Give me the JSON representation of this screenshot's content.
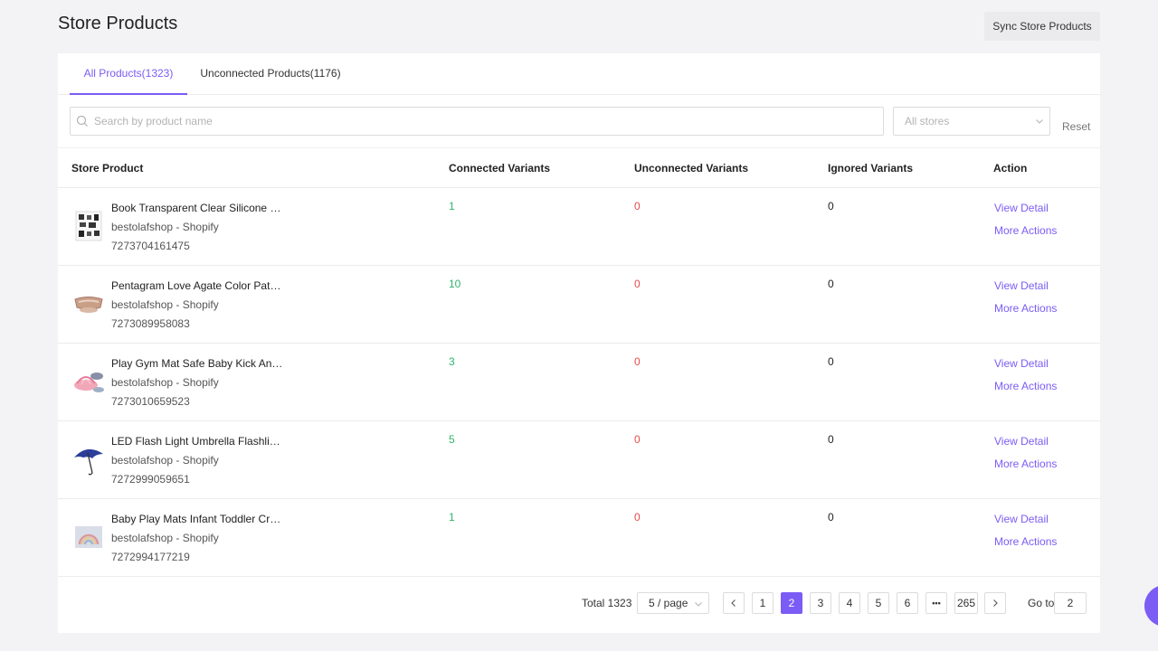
{
  "header": {
    "title": "Store Products",
    "sync_label": "Sync Store Products"
  },
  "tabs": [
    {
      "label": "All Products(1323)",
      "active": true
    },
    {
      "label": "Unconnected Products(1176)",
      "active": false
    }
  ],
  "filters": {
    "search_placeholder": "Search by product name",
    "store_placeholder": "All stores",
    "reset_label": "Reset"
  },
  "table": {
    "columns": [
      "Store Product",
      "Connected Variants",
      "Unconnected Variants",
      "Ignored Variants",
      "Action"
    ],
    "actions": {
      "view": "View Detail",
      "more": "More Actions"
    },
    "rows": [
      {
        "name": "Book Transparent Clear Silicone St...",
        "store": "bestolafshop - Shopify",
        "id": "7273704161475",
        "connected": "1",
        "unconnected": "0",
        "ignored": "0",
        "thumb_icon": "stamp-sheet-icon"
      },
      {
        "name": "Pentagram Love Agate Color Patte...",
        "store": "bestolafshop - Shopify",
        "id": "7273089958083",
        "connected": "10",
        "unconnected": "0",
        "ignored": "0",
        "thumb_icon": "bracelet-icon"
      },
      {
        "name": "Play Gym Mat Safe Baby Kick And ...",
        "store": "bestolafshop - Shopify",
        "id": "7273010659523",
        "connected": "3",
        "unconnected": "0",
        "ignored": "0",
        "thumb_icon": "play-mat-icon"
      },
      {
        "name": "LED Flash Light Umbrella Flashligh...",
        "store": "bestolafshop - Shopify",
        "id": "7272999059651",
        "connected": "5",
        "unconnected": "0",
        "ignored": "0",
        "thumb_icon": "umbrella-icon"
      },
      {
        "name": "Baby Play Mats Infant Toddler Cra...",
        "store": "bestolafshop - Shopify",
        "id": "7272994177219",
        "connected": "1",
        "unconnected": "0",
        "ignored": "0",
        "thumb_icon": "rainbow-mat-icon"
      }
    ]
  },
  "pagination": {
    "total_label": "Total 1323",
    "page_size": "5 / page",
    "pages": [
      "1",
      "2",
      "3",
      "4",
      "5",
      "6",
      "•••",
      "265"
    ],
    "current": "2",
    "goto_label": "Go to",
    "goto_value": "2"
  },
  "colors": {
    "accent": "#7b5cf5",
    "connected": "#2fb46a",
    "unconnected": "#e84b4b"
  }
}
